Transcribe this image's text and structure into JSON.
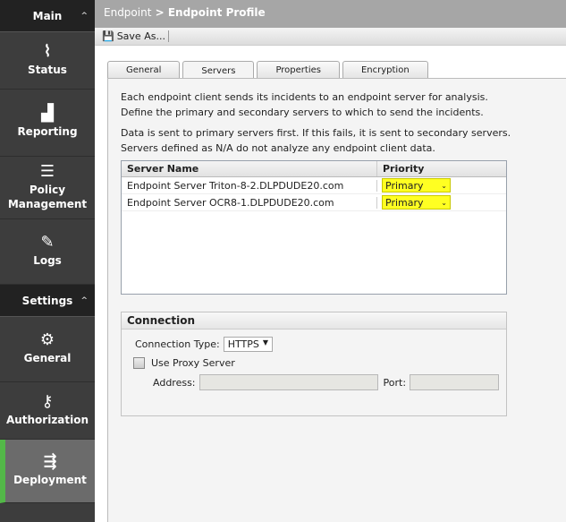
{
  "sidebar": {
    "main_header": "Main",
    "settings_header": "Settings",
    "items": [
      {
        "label": "Status",
        "icon": "pulse-icon"
      },
      {
        "label": "Reporting",
        "icon": "bar-chart-icon"
      },
      {
        "label": "Policy Management",
        "icon": "list-check-icon"
      },
      {
        "label": "Logs",
        "icon": "document-edit-icon"
      }
    ],
    "settings_items": [
      {
        "label": "General",
        "icon": "gear-icon"
      },
      {
        "label": "Authorization",
        "icon": "user-key-icon"
      },
      {
        "label": "Deployment",
        "icon": "deployment-icon"
      }
    ],
    "accent": "#53b848"
  },
  "header": {
    "crumb1": "Endpoint",
    "sep": " > ",
    "crumb2": "Endpoint Profile"
  },
  "toolbar": {
    "save_as": "Save As..."
  },
  "tabs": [
    "General",
    "Servers",
    "Properties",
    "Encryption"
  ],
  "servers": {
    "intro1": "Each endpoint client sends its incidents to an endpoint server for analysis.",
    "intro2": "Define the primary and secondary servers to which to send the incidents.",
    "note1": "Data is sent to primary servers first. If this fails, it is sent to secondary servers.",
    "note2": "Servers defined as N/A do not analyze any endpoint client data.",
    "col_name": "Server Name",
    "col_priority": "Priority",
    "rows": [
      {
        "name": "Endpoint Server Triton-8-2.DLPDUDE20.com",
        "priority": "Primary"
      },
      {
        "name": "Endpoint Server OCR8-1.DLPDUDE20.com",
        "priority": "Primary"
      }
    ]
  },
  "connection": {
    "title": "Connection",
    "type_label": "Connection Type:",
    "type_value": "HTTPS",
    "proxy_label": "Use Proxy Server",
    "address_label": "Address:",
    "address_value": "",
    "port_label": "Port:",
    "port_value": ""
  }
}
